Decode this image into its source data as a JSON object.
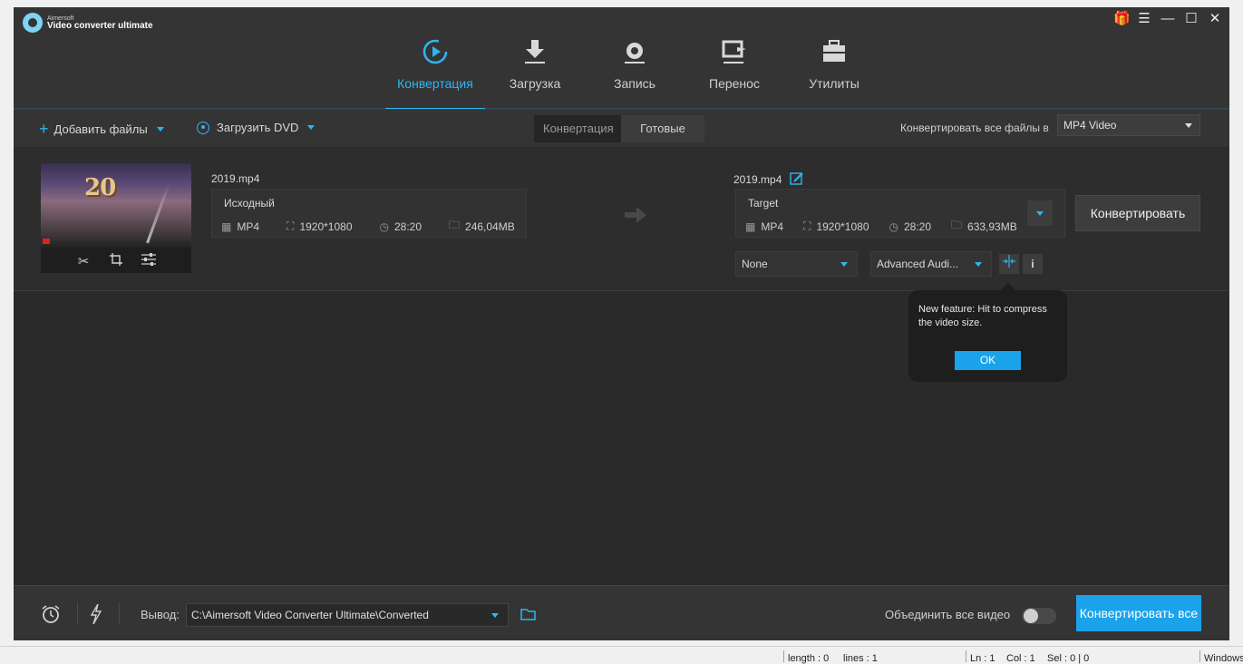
{
  "app": {
    "brand": "Aimersoft",
    "name": "Video converter ultimate"
  },
  "window_controls": [
    "gift-icon",
    "menu-icon",
    "minimize-icon",
    "maximize-icon",
    "close-icon"
  ],
  "tabs": [
    {
      "label": "Конвертация",
      "icon": "convert-icon",
      "active": true
    },
    {
      "label": "Загрузка",
      "icon": "download-icon",
      "active": false
    },
    {
      "label": "Запись",
      "icon": "record-icon",
      "active": false
    },
    {
      "label": "Перенос",
      "icon": "transfer-icon",
      "active": false
    },
    {
      "label": "Утилиты",
      "icon": "toolbox-icon",
      "active": false
    }
  ],
  "toolbar": {
    "add_files": "Добавить файлы",
    "load_dvd": "Загрузить DVD",
    "seg_converting": "Конвертация",
    "seg_done": "Готовые",
    "convert_all_to": "Конвертировать все файлы в",
    "format": "MP4 Video"
  },
  "file": {
    "source_name": "2019.mp4",
    "source": {
      "header": "Исходный",
      "format": "MP4",
      "resolution": "1920*1080",
      "duration": "28:20",
      "size": "246,04MB"
    },
    "target_name": "2019.mp4",
    "target": {
      "header": "Target",
      "format": "MP4",
      "resolution": "1920*1080",
      "duration": "28:20",
      "size": "633,93MB"
    },
    "subtitle_select": "None",
    "audio_select": "Advanced Audi...",
    "convert_button": "Конвертировать"
  },
  "popup": {
    "message": "New feature: Hit to compress the video size.",
    "ok": "OK"
  },
  "bottom": {
    "output_label": "Вывод:",
    "output_path": "C:\\Aimersoft Video Converter Ultimate\\Converted",
    "merge_label": "Объединить все видео",
    "merge_enabled": false,
    "convert_all": "Конвертировать все"
  },
  "statusbar": {
    "length": "length : 0",
    "lines": "lines : 1",
    "ln": "Ln : 1",
    "col": "Col : 1",
    "sel": "Sel : 0 | 0",
    "eol": "Windows"
  },
  "colors": {
    "accent": "#2eb6f2",
    "primary_button": "#1aa3ea",
    "background": "#2b2a2b"
  }
}
